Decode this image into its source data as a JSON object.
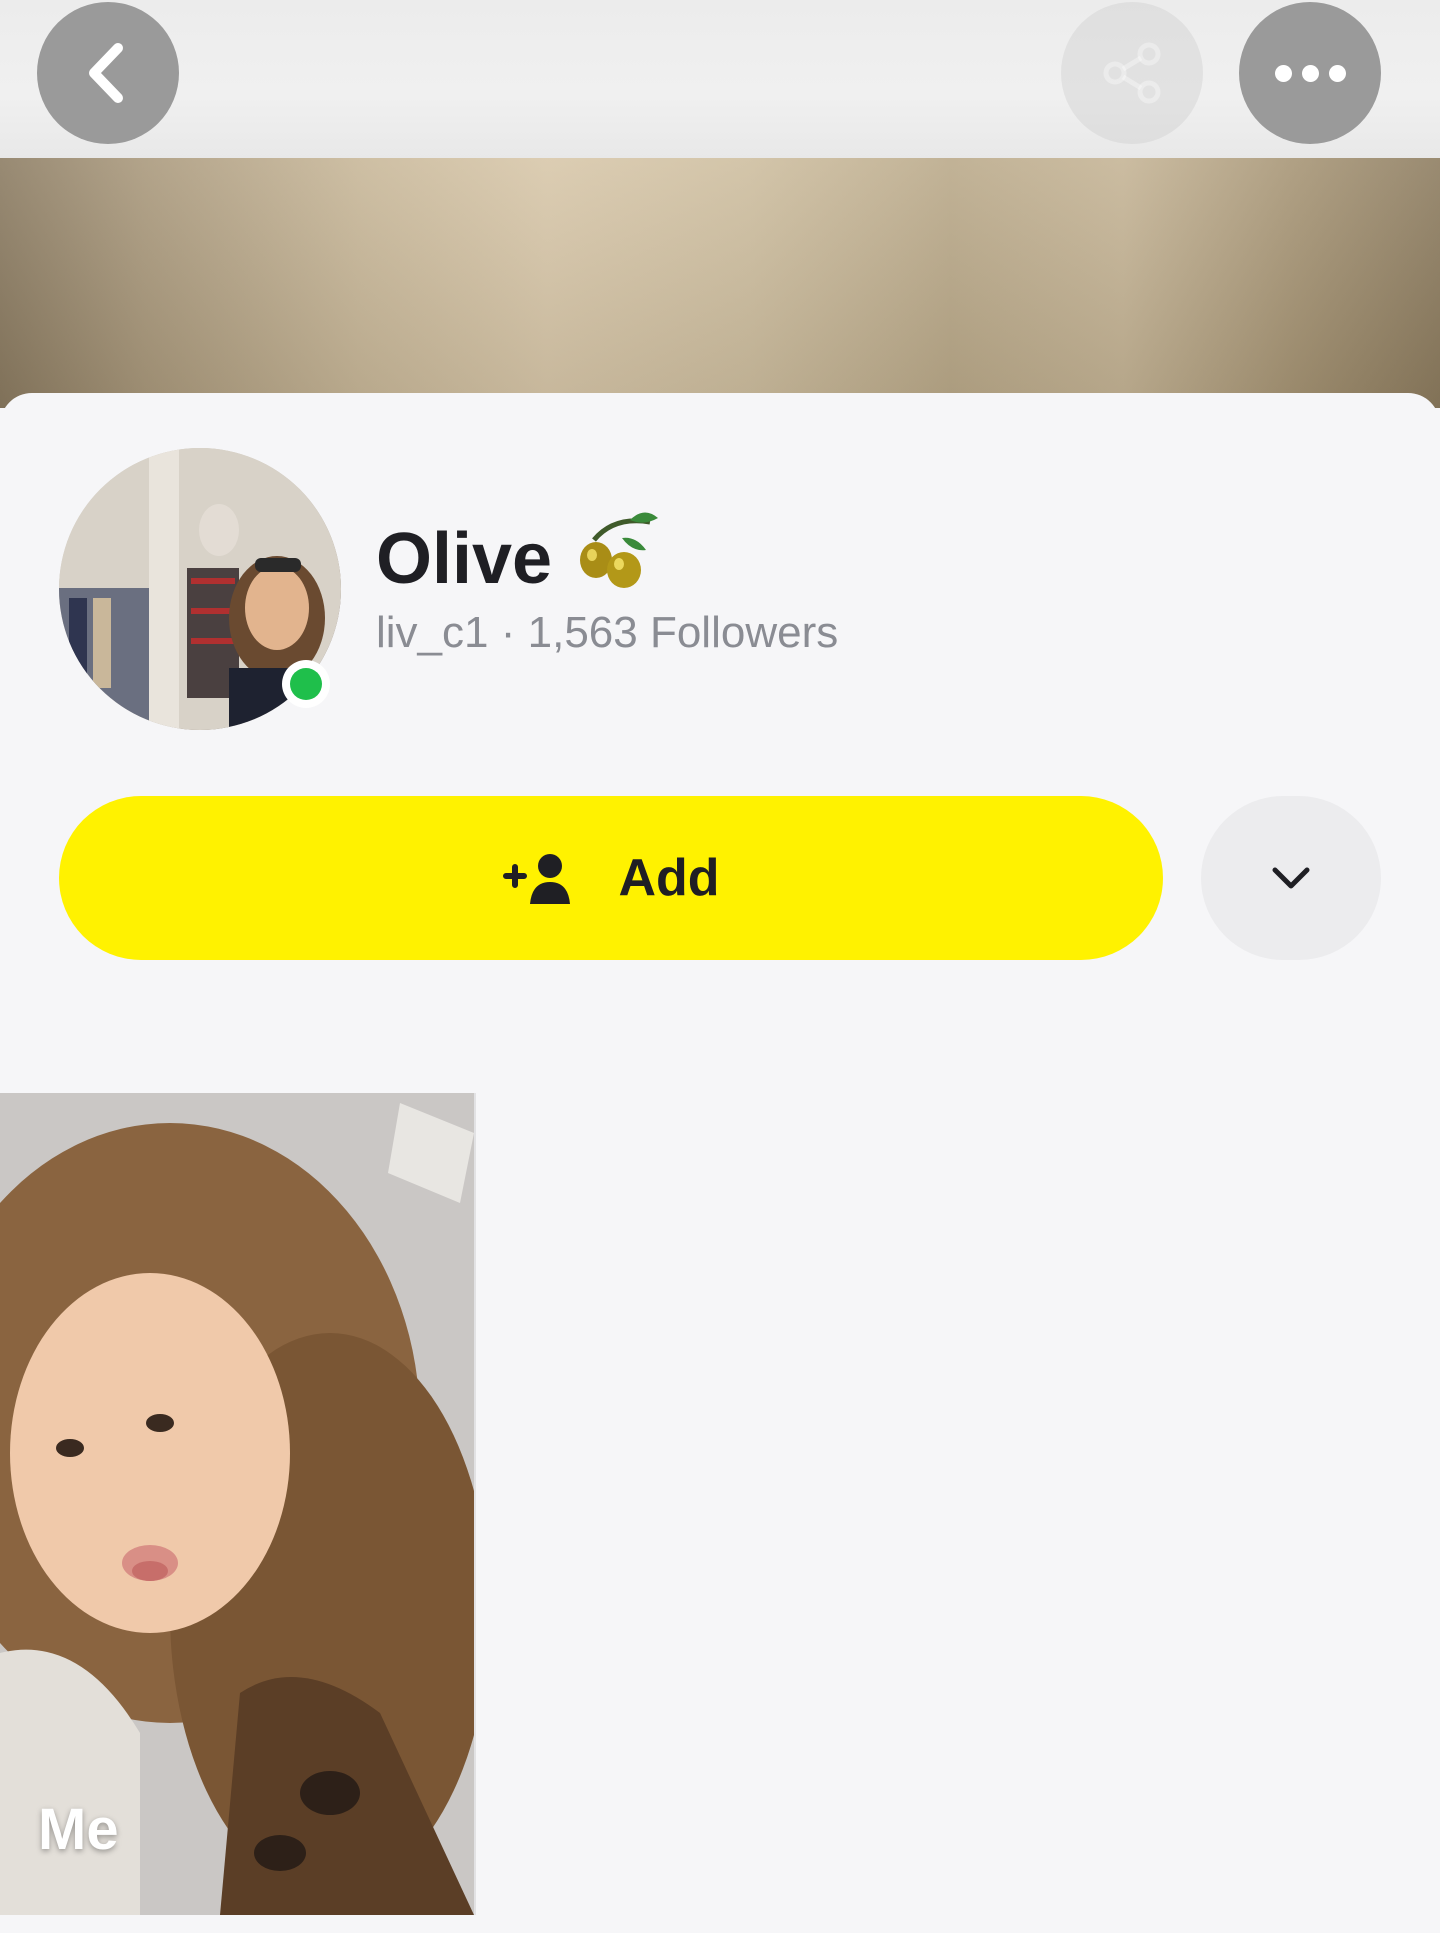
{
  "header": {
    "back_icon": "chevron-left-icon",
    "share_icon": "share-icon",
    "more_icon": "ellipsis-icon"
  },
  "profile": {
    "display_name": "Olive",
    "name_emoji": "🫒",
    "username": "liv_c1",
    "separator": "·",
    "followers": "1,563 Followers",
    "online": true
  },
  "actions": {
    "add_label": "Add",
    "add_icon": "add-friend-icon",
    "dropdown_icon": "chevron-down-icon"
  },
  "stories": [
    {
      "label": "Me"
    }
  ],
  "colors": {
    "accent_yellow": "#fff200",
    "online_green": "#1fbf4b",
    "text_dark": "#1f1f24",
    "text_muted": "#8a8c93"
  }
}
